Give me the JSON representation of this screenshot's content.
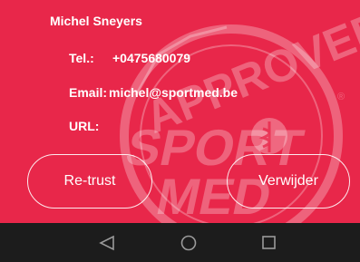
{
  "contact": {
    "name": "Michel Sneyers",
    "tel_label": "Tel.:",
    "tel_value": "+0475680079",
    "email_label": "Email:",
    "email_value": "michel@sportmed.be",
    "url_label": "URL:"
  },
  "stamp": {
    "top_text": "APPROVED",
    "brand_line1": "SPORT",
    "brand_line2": "MED",
    "registered_mark": "®"
  },
  "actions": {
    "retrust_label": "Re-trust",
    "remove_label": "Verwijder"
  },
  "navbar": {
    "back_icon": "back-triangle-icon",
    "home_icon": "home-circle-icon",
    "recents_icon": "recents-square-icon"
  },
  "colors": {
    "card_background": "#e8274a",
    "navbar_background": "#1c1c1c",
    "text": "#ffffff"
  }
}
